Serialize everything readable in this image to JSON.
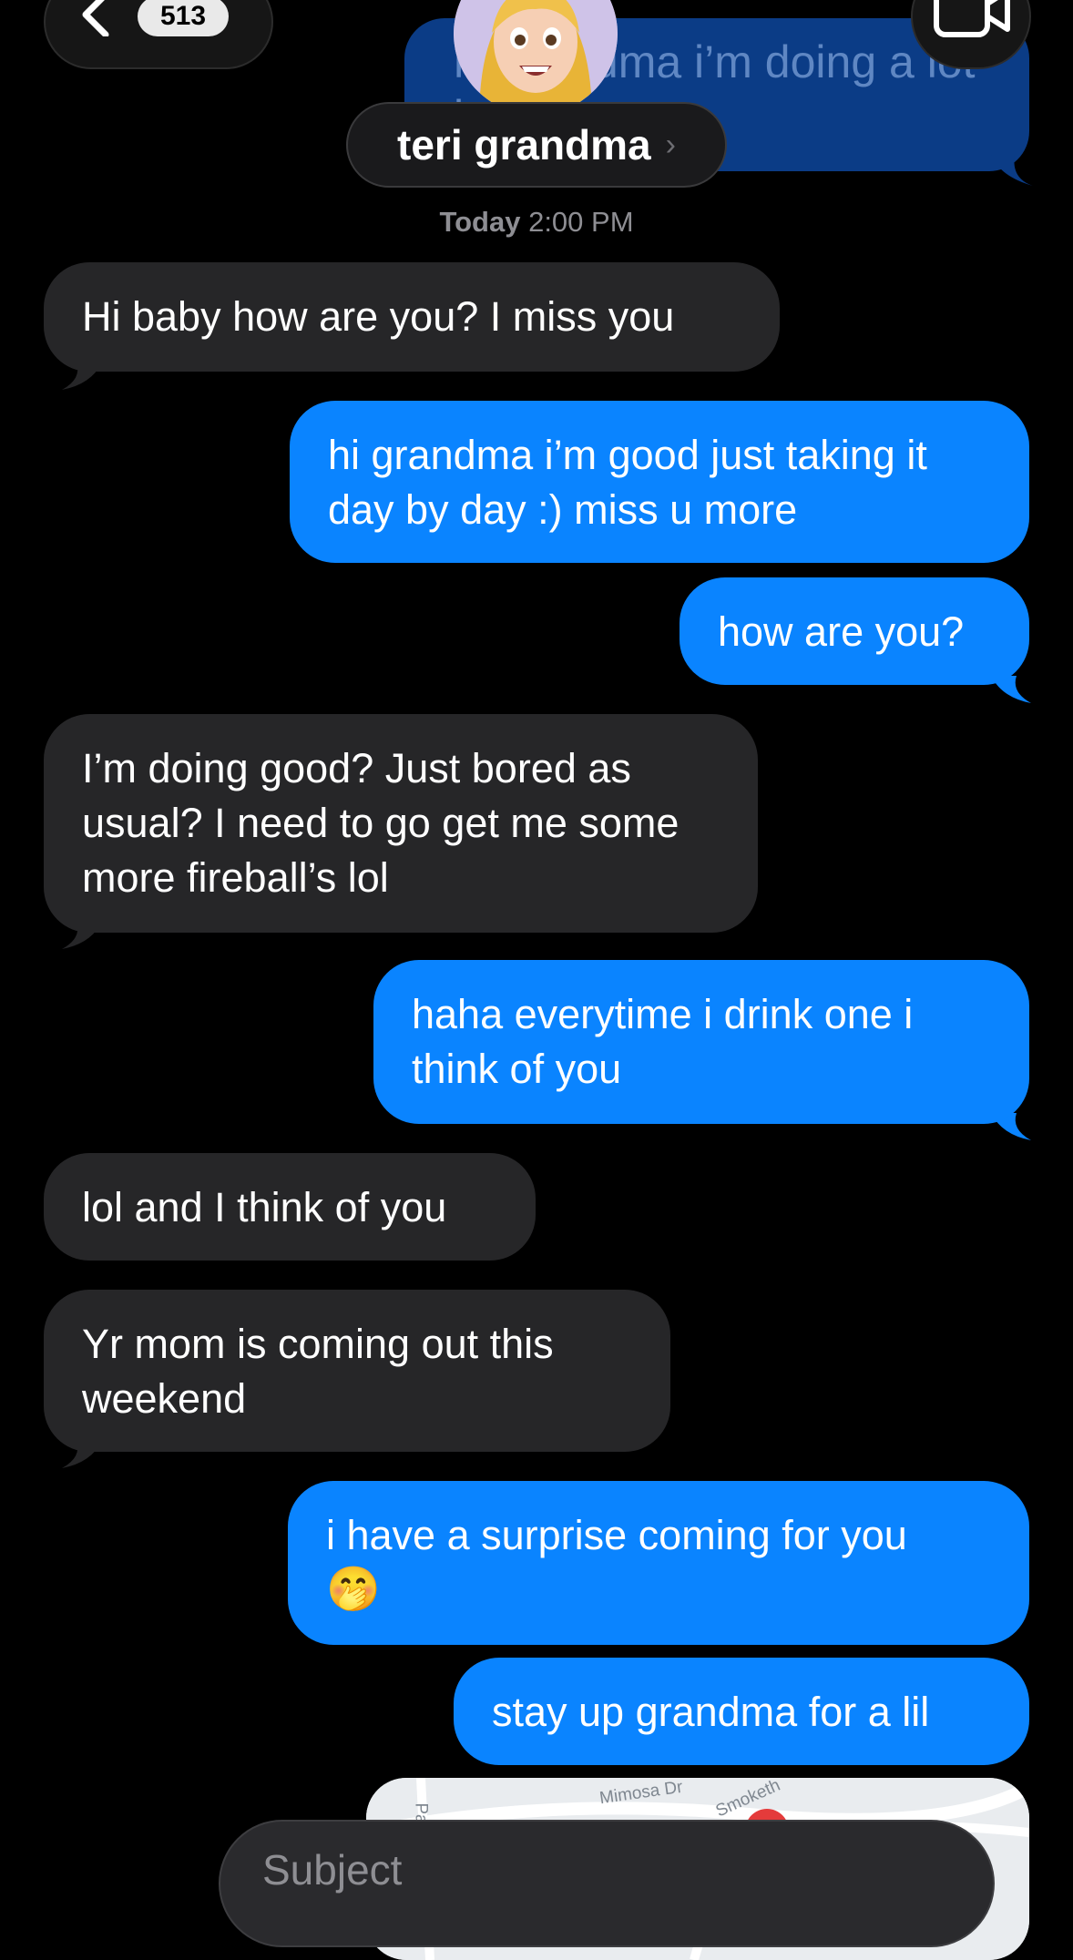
{
  "header": {
    "back_badge": "513",
    "contact_name": "teri grandma",
    "name_chevron": "›",
    "ghost_message": "hi grandma i’m doing a lot better"
  },
  "timestamp": {
    "day": "Today",
    "time": "2:00 PM"
  },
  "messages": [
    {
      "dir": "in",
      "text": "Hi baby how are you? I miss you"
    },
    {
      "dir": "out",
      "text": "hi grandma i’m good just taking it day by day :) miss u more"
    },
    {
      "dir": "out",
      "text": "how are you?"
    },
    {
      "dir": "in",
      "text": "I’m doing good? Just bored as usual? I need to go get me some more fireball’s lol"
    },
    {
      "dir": "out",
      "text": "haha everytime i drink one i think of you"
    },
    {
      "dir": "in",
      "text": "lol and I think of you"
    },
    {
      "dir": "in",
      "text": "Yr mom is coming out this weekend"
    },
    {
      "dir": "out",
      "text": "i have a surprise coming for you",
      "emoji": "🤭"
    },
    {
      "dir": "out",
      "text": "stay up grandma for a lil"
    }
  ],
  "map_preview": {
    "street_1": "Mimosa Dr",
    "street_2": "Smoketh",
    "street_3": "Pa"
  },
  "compose": {
    "placeholder": "Subject"
  },
  "colors": {
    "outgoing": "#0a84ff",
    "incoming": "#262628",
    "background": "#000000"
  },
  "icons": [
    "chevron-left-icon",
    "video-camera-icon",
    "memoji-avatar-icon"
  ]
}
